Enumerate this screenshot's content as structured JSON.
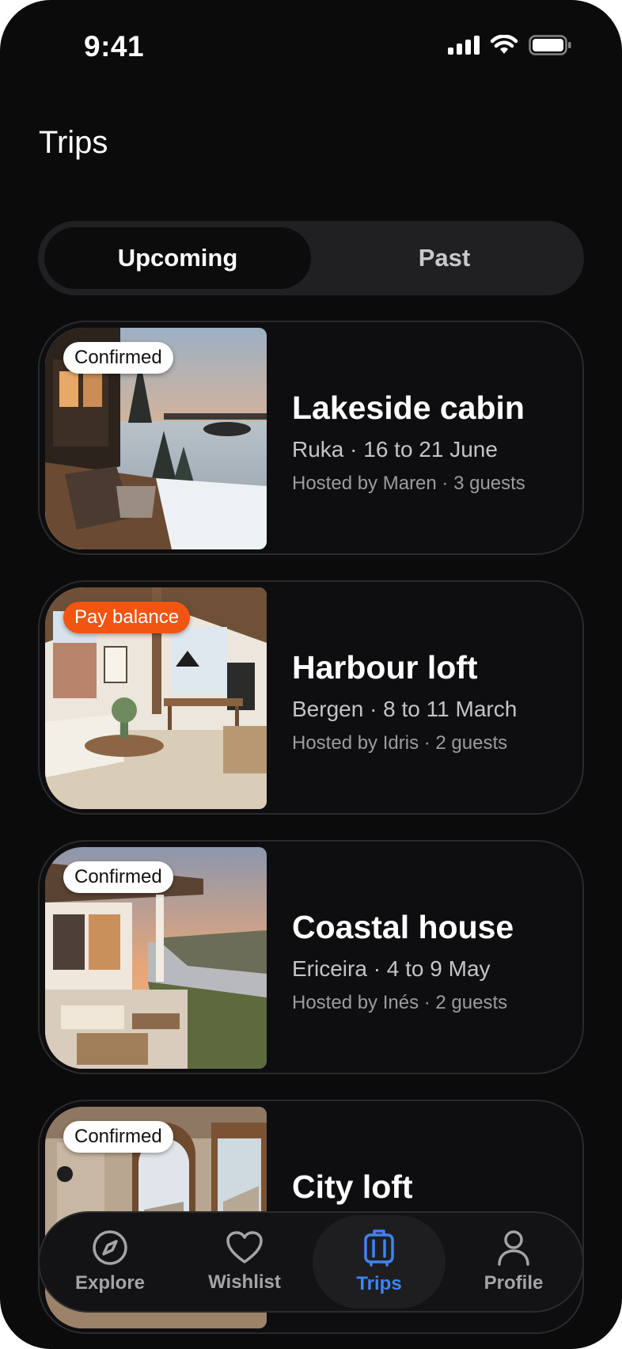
{
  "status": {
    "time": "9:41"
  },
  "page": {
    "title": "Trips"
  },
  "segmented": {
    "upcoming": "Upcoming",
    "past": "Past",
    "selected": "Upcoming"
  },
  "trips": [
    {
      "badge": "Confirmed",
      "title": "Lakeside cabin",
      "subtitle": "Ruka · 16 to 21 June",
      "meta": "Hosted by Maren · 3 guests"
    },
    {
      "badge": "Pay balance",
      "title": "Harbour loft",
      "subtitle": "Bergen · 8 to 11 March",
      "meta": "Hosted by Idris · 2 guests"
    },
    {
      "badge": "Confirmed",
      "title": "Coastal house",
      "subtitle": "Ericeira · 4 to 9 May",
      "meta": "Hosted by Inés · 2 guests"
    },
    {
      "badge": "Confirmed",
      "title": "City loft"
    }
  ],
  "tabbar": {
    "items": [
      {
        "label": "Explore",
        "icon": "compass-icon"
      },
      {
        "label": "Wishlist",
        "icon": "heart-icon"
      },
      {
        "label": "Trips",
        "icon": "suitcase-icon"
      },
      {
        "label": "Profile",
        "icon": "person-icon"
      }
    ],
    "selected": "Trips"
  },
  "colors": {
    "background": "#0b0b0c",
    "accent": "#3f84f0",
    "warning_badge": "#f25412"
  }
}
